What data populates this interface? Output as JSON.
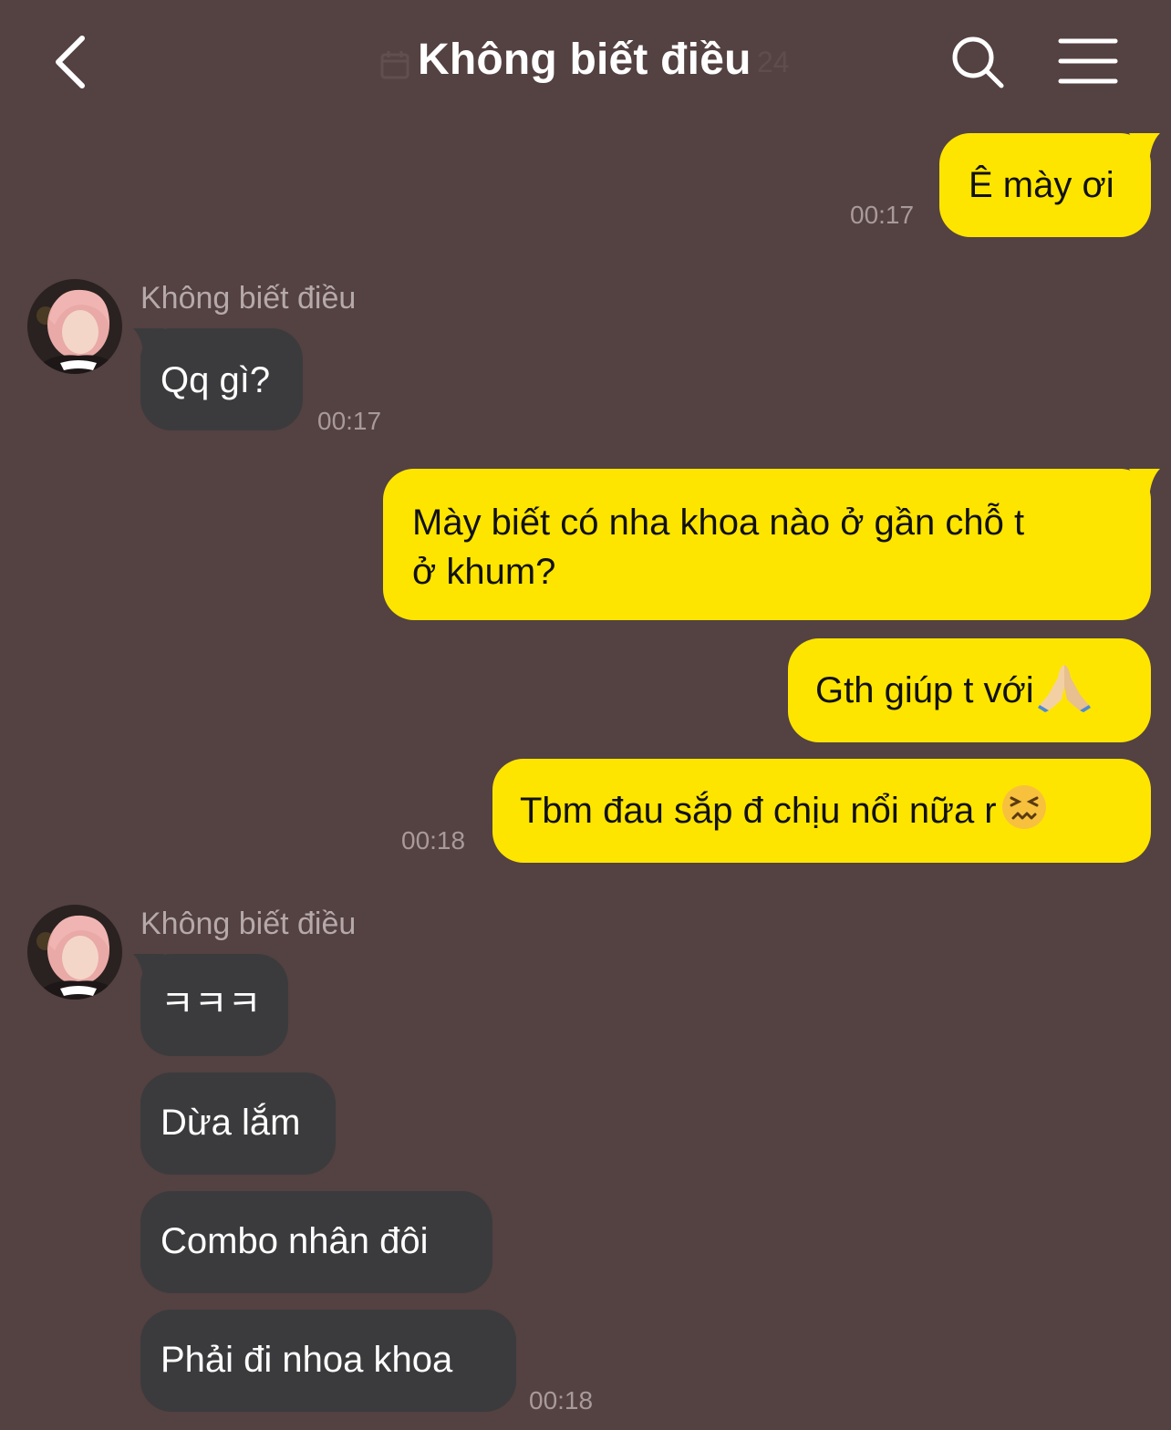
{
  "header": {
    "title": "Không biết điều",
    "ghost_date": "24",
    "icons": {
      "back": "chevron-left-icon",
      "search": "search-icon",
      "menu": "hamburger-menu-icon",
      "calendar": "calendar-icon"
    }
  },
  "colors": {
    "background": "#544142",
    "my_bubble": "#fee500",
    "their_bubble": "#3b3b3d",
    "timestamp": "#a99a9a"
  },
  "messages": [
    {
      "from": "me",
      "text": "Ê mày ơi",
      "time": "00:17"
    },
    {
      "from": "them",
      "sender": "Không biết điều",
      "text": "Qq gì?",
      "time": "00:17"
    },
    {
      "from": "me",
      "text_line1": "Mày biết có nha khoa nào ở gần chỗ t",
      "text_line2": "ở khum?"
    },
    {
      "from": "me",
      "text": "Gth giúp t với",
      "emoji": "folded-hands-emoji"
    },
    {
      "from": "me",
      "text": "Tbm đau sắp đ chịu nổi nữa r",
      "emoji": "confounded-face-emoji",
      "time": "00:18"
    },
    {
      "from": "them",
      "sender": "Không biết điều",
      "text": "ㅋㅋㅋ"
    },
    {
      "from": "them",
      "text": "Dừa lắm"
    },
    {
      "from": "them",
      "text": "Combo nhân đôi"
    },
    {
      "from": "them",
      "text": "Phải đi nhoa khoa",
      "time": "00:18"
    }
  ]
}
